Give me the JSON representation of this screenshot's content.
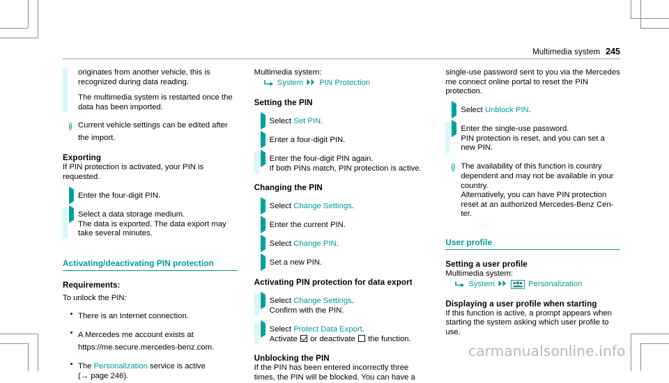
{
  "header": {
    "title": "Multimedia system",
    "page_number": "245"
  },
  "watermark": "carmanualsonline.info",
  "colors": {
    "teal": "#009999",
    "margin_bar": "#d6f9fd",
    "rule": "#9aa3a3"
  },
  "left_column": {
    "continued_para_1": "originates from another vehicle, this is recognized during data reading.",
    "continued_para_2": "The multimedia system is restarted once the data has been imported.",
    "note_1": "Current vehicle settings can be edited after the import.",
    "exporting_heading": "Exporting",
    "exporting_intro": "If PIN protection is activated, your PIN is requested.",
    "steps": [
      {
        "text": "Enter the four-digit PIN."
      },
      {
        "text": "Select a data storage medium."
      }
    ],
    "steps_note": "The data is exported. The data export may take several minutes.",
    "section_heading": "Activating/deactivating PIN protection",
    "requirements_heading": "Requirements:",
    "requirements_intro": "To unlock the PIN:",
    "requirements": [
      {
        "text": "There is an Internet connection."
      },
      {
        "text": "A Mercedes me account exists at https://me.secure.mercedes-benz.com."
      },
      {
        "text_before": "The ",
        "link": "Personalization",
        "text_after": " service is active"
      },
      {
        "reference": "(→ page 246)."
      }
    ]
  },
  "middle_column": {
    "intro": "Multimedia system:",
    "nav_path": {
      "first_icon": "bent-arrow-icon",
      "first_label": "System",
      "separator_icon": "double-chevron-icon",
      "second_label": "PIN Protection"
    },
    "setting_heading": "Setting the PIN",
    "setting_steps": [
      {
        "prefix": "Select ",
        "link": "Set PIN",
        "suffix": "."
      },
      {
        "prefix": "Enter a four-digit PIN."
      },
      {
        "prefix": "Enter the four-digit PIN again."
      }
    ],
    "setting_note": "If both PINs match, PIN protection is active.",
    "changing_heading": "Changing the PIN",
    "changing_steps": [
      {
        "prefix": "Select ",
        "link": "Change Settings",
        "suffix": "."
      },
      {
        "prefix": "Enter the current PIN."
      },
      {
        "prefix": "Select ",
        "link": "Change PIN",
        "suffix": "."
      },
      {
        "prefix": "Set a new PIN."
      }
    ],
    "activating_heading": "Activating PIN protection for data export",
    "activating_step_1": {
      "prefix": "Select ",
      "link": "Change Settings",
      "suffix": "."
    },
    "activating_step_1_note": "Confirm with the PIN.",
    "activating_step_2": {
      "prefix": "Select ",
      "link": "Protect Data Export",
      "suffix": "."
    },
    "activating_step_2_note": {
      "before": "Activate ",
      "middle": " or deactivate ",
      "after": " the function."
    },
    "unblocking_heading": "Unblocking the PIN",
    "unblocking_text": "If the PIN has been entered incorrectly three times, the PIN will be blocked. You can have a"
  },
  "right_column": {
    "continued_text": "single-use password sent to you via the Mercedes me connect online portal to reset the PIN protection.",
    "steps": [
      {
        "prefix": "Select ",
        "link": "Unblock PIN",
        "suffix": "."
      },
      {
        "prefix": "Enter the single-use password."
      }
    ],
    "step_note": "PIN protection is reset, and you can set a new PIN.",
    "note": "The availability of this function is country dependent and may not be available in your country.\nAlternatively, you can have PIN protection reset at an authorized Mercedes-Benz Center.",
    "note_line_1": "The availability of this function is country",
    "note_line_2": "dependent and may not be available in your",
    "note_line_3": "country.",
    "note_line_4": "Alternatively, you can have PIN protection",
    "note_line_5": "reset at an authorized Mercedes-Benz Cen-",
    "note_line_6": "ter.",
    "section_heading": "User profile",
    "setting_profile_heading": "Setting a user profile",
    "intro": "Multimedia system:",
    "nav_path": {
      "first_icon": "bent-arrow-icon",
      "first_label": "System",
      "separator_icon": "double-chevron-icon",
      "box_icon": "people-group-icon",
      "second_label": "Personalization"
    },
    "displaying_heading": "Displaying a user profile when starting",
    "displaying_text": "If this function is active, a prompt appears when starting the system asking which user profile to use."
  }
}
